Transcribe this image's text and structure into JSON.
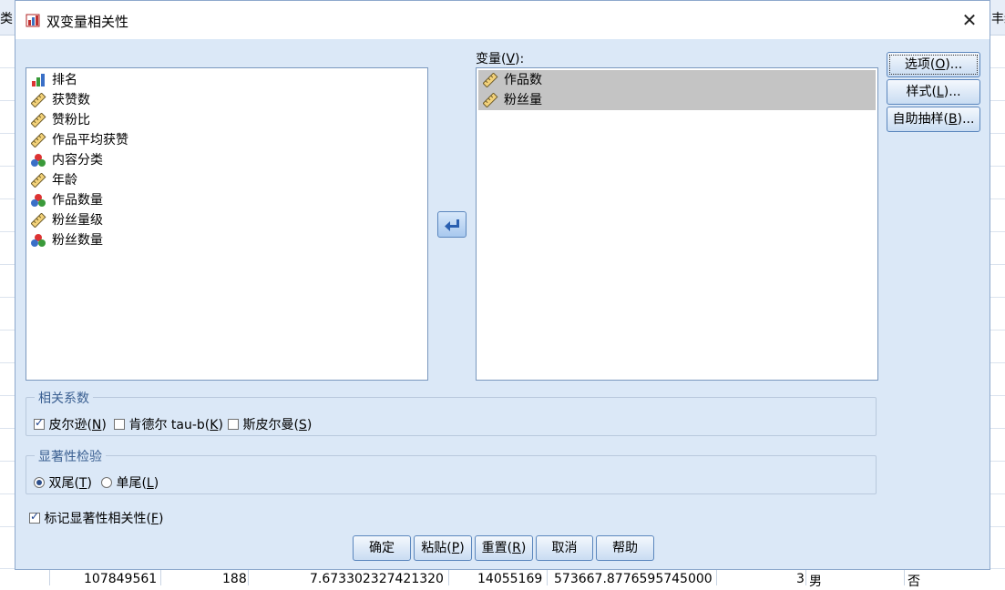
{
  "dialog": {
    "title": "双变量相关性",
    "close_glyph": "✕"
  },
  "background": {
    "header_left": "类",
    "header_right": "丰约",
    "row_cells": [
      "107849561",
      "188",
      "7.673302327421320",
      "14055169",
      "573667.8776595745000",
      "3",
      "男",
      "否"
    ]
  },
  "source_list": {
    "items": [
      {
        "label": "排名",
        "icon": "ordinal-bar-icon"
      },
      {
        "label": "获赞数",
        "icon": "scale-ruler-icon"
      },
      {
        "label": "赞粉比",
        "icon": "scale-ruler-icon"
      },
      {
        "label": "作品平均获赞",
        "icon": "scale-ruler-icon"
      },
      {
        "label": "内容分类",
        "icon": "nominal-balls-icon"
      },
      {
        "label": "年龄",
        "icon": "scale-ruler-icon"
      },
      {
        "label": "作品数量",
        "icon": "nominal-balls-icon"
      },
      {
        "label": "粉丝量级",
        "icon": "scale-ruler-icon"
      },
      {
        "label": "粉丝数量",
        "icon": "nominal-balls-icon"
      }
    ]
  },
  "variables": {
    "label": "变量(",
    "label_key": "V",
    "label_end": "):",
    "items": [
      {
        "label": "作品数",
        "icon": "scale-ruler-icon"
      },
      {
        "label": "粉丝量",
        "icon": "scale-ruler-icon"
      }
    ]
  },
  "side_buttons": {
    "options": {
      "text": "选项(",
      "key": "O",
      "end": ")..."
    },
    "style": {
      "text": "样式(",
      "key": "L",
      "end": ")..."
    },
    "bootstrap": {
      "text": "自助抽样(",
      "key": "B",
      "end": ")..."
    }
  },
  "correlation": {
    "title": "相关系数",
    "pearson": {
      "text": "皮尔逊(",
      "key": "N",
      "end": ")",
      "checked": true
    },
    "kendall": {
      "text": "肯德尔 tau-b(",
      "key": "K",
      "end": ")",
      "checked": false
    },
    "spearman": {
      "text": "斯皮尔曼(",
      "key": "S",
      "end": ")",
      "checked": false
    }
  },
  "significance": {
    "title": "显著性检验",
    "two_tailed": {
      "text": "双尾(",
      "key": "T",
      "end": ")",
      "selected": true
    },
    "one_tailed": {
      "text": "单尾(",
      "key": "L",
      "end": ")",
      "selected": false
    }
  },
  "flag": {
    "text": "标记显著性相关性(",
    "key": "F",
    "end": ")",
    "checked": true
  },
  "bottom_buttons": {
    "ok": "确定",
    "paste": {
      "text": "粘贴(",
      "key": "P",
      "end": ")"
    },
    "reset": {
      "text": "重置(",
      "key": "R",
      "end": ")"
    },
    "cancel": "取消",
    "help": "帮助"
  },
  "colors": {
    "dialog_bg": "#dbe8f7",
    "selection": "#c4c4c4",
    "group_title": "#3a5f91"
  }
}
